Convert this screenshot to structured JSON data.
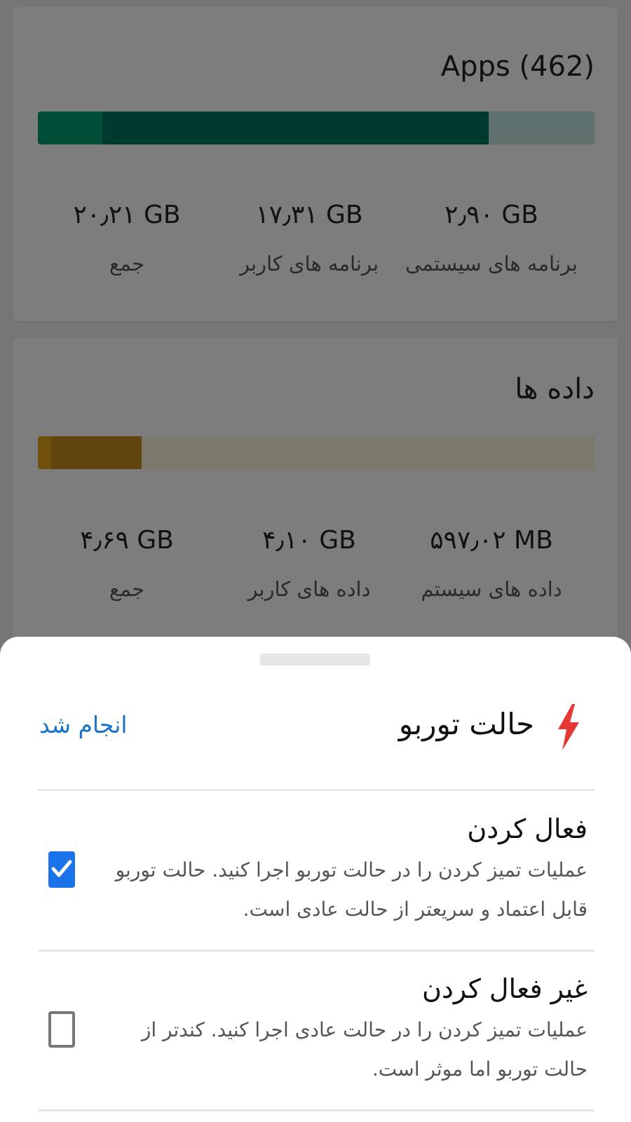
{
  "apps_card": {
    "title": "Apps (462)",
    "usage": {
      "system_fraction": 0.116,
      "user_fraction": 0.694,
      "used_fraction": 0.81
    },
    "colors": {
      "system": "#009a6f",
      "user": "#00725a",
      "track": "#bfe3dc"
    },
    "stats": [
      {
        "value": "۲۰٫۲۱ GB",
        "label": "جمع"
      },
      {
        "value": "۱۷٫۳۱ GB",
        "label": "برنامه های کاربر"
      },
      {
        "value": "۲٫۹۰ GB",
        "label": "برنامه های سیستمی"
      }
    ]
  },
  "data_card": {
    "title": "داده ها",
    "usage": {
      "system_fraction": 0.024,
      "user_fraction": 0.163,
      "used_fraction": 0.187
    },
    "colors": {
      "system": "#e0a21a",
      "user": "#c18d18",
      "track": "#fbf0d8"
    },
    "stats": [
      {
        "value": "۴٫۶۹ GB",
        "label": "جمع"
      },
      {
        "value": "۴٫۱۰ GB",
        "label": "داده های کاربر"
      },
      {
        "value": "۵۹۷٫۰۲ MB",
        "label": "داده های سیستم"
      }
    ]
  },
  "turbo_sheet": {
    "title": "حالت توربو",
    "icon": "lightning-bolt-icon",
    "icon_color": "#e53935",
    "done_label": "انجام شد",
    "options": [
      {
        "title": "فعال کردن",
        "description": "عملیات تمیز کردن را در حالت توربو اجرا کنید. حالت توربو قابل اعتماد و سریعتر از حالت عادی است.",
        "checked": true
      },
      {
        "title": "غیر فعال کردن",
        "description": "عملیات تمیز کردن را در حالت عادی اجرا کنید. کندتر از حالت توربو اما موثر است.",
        "checked": false
      }
    ]
  }
}
